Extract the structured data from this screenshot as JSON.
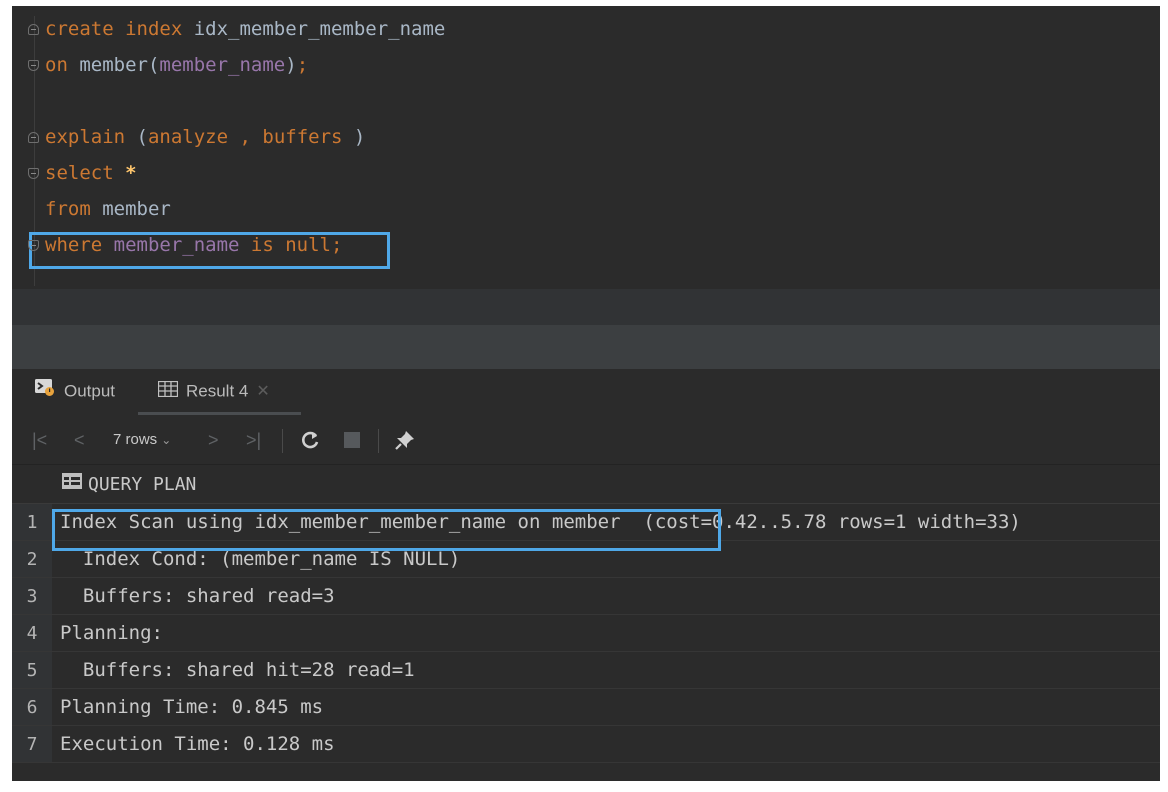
{
  "editor": {
    "lines": [
      {
        "parts": [
          {
            "t": "create index ",
            "c": "kw"
          },
          {
            "t": "idx_member_member_name",
            "c": "pl"
          }
        ]
      },
      {
        "parts": [
          {
            "t": "on ",
            "c": "kw"
          },
          {
            "t": "member(",
            "c": "pl"
          },
          {
            "t": "member_name",
            "c": "col"
          },
          {
            "t": ")",
            "c": "pl"
          },
          {
            "t": ";",
            "c": "kw"
          }
        ]
      },
      {
        "parts": []
      },
      {
        "parts": [
          {
            "t": "explain ",
            "c": "kw"
          },
          {
            "t": "(",
            "c": "pl"
          },
          {
            "t": "analyze ",
            "c": "kw"
          },
          {
            "t": ", ",
            "c": "kw"
          },
          {
            "t": "buffers ",
            "c": "kw"
          },
          {
            "t": ")",
            "c": "pl"
          }
        ]
      },
      {
        "parts": [
          {
            "t": "select ",
            "c": "kw"
          },
          {
            "t": "*",
            "c": "star"
          }
        ]
      },
      {
        "parts": [
          {
            "t": "from ",
            "c": "kw"
          },
          {
            "t": "member",
            "c": "pl"
          }
        ]
      },
      {
        "parts": [
          {
            "t": "where ",
            "c": "kw"
          },
          {
            "t": "member_name ",
            "c": "col"
          },
          {
            "t": "is null",
            "c": "kw"
          },
          {
            "t": ";",
            "c": "kw"
          }
        ]
      }
    ]
  },
  "tabs": [
    {
      "label": "Output",
      "icon": "console-output-icon",
      "active": false
    },
    {
      "label": "Result 4",
      "icon": "table-icon",
      "active": true,
      "closable": true
    }
  ],
  "toolbar": {
    "rows_label": "7 rows",
    "buttons": [
      "first-page-icon",
      "previous-page-icon",
      "next-page-icon",
      "last-page-icon",
      "refresh-icon",
      "stop-icon",
      "pin-icon"
    ]
  },
  "result": {
    "column": "QUERY PLAN",
    "rows": [
      {
        "n": "1",
        "v": "Index Scan using idx_member_member_name on member  (cost=0.42..5.78 rows=1 width=33)"
      },
      {
        "n": "2",
        "v": "  Index Cond: (member_name IS NULL)"
      },
      {
        "n": "3",
        "v": "  Buffers: shared read=3"
      },
      {
        "n": "4",
        "v": "Planning:"
      },
      {
        "n": "5",
        "v": "  Buffers: shared hit=28 read=1"
      },
      {
        "n": "6",
        "v": "Planning Time: 0.845 ms"
      },
      {
        "n": "7",
        "v": "Execution Time: 0.128 ms"
      }
    ]
  },
  "colors": {
    "keyword": "#cc7832",
    "column": "#9876aa",
    "highlight": "#4fa8e8",
    "background": "#2b2b2b"
  }
}
